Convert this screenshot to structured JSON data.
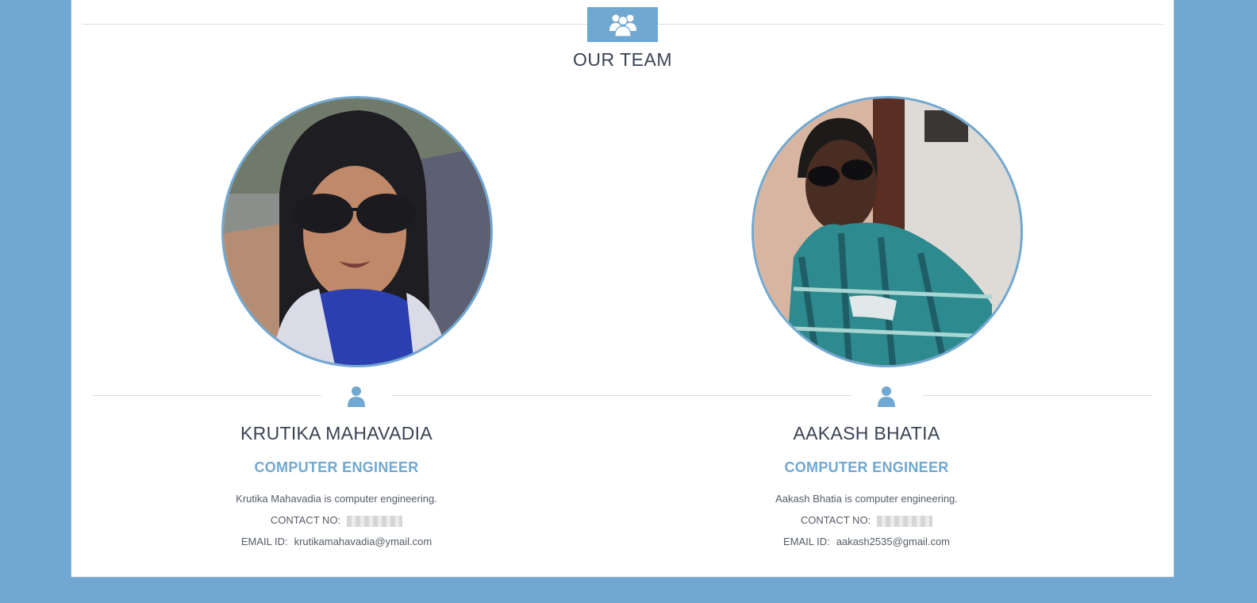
{
  "section": {
    "title": "OUR TEAM",
    "icon": "team-icon"
  },
  "members": [
    {
      "name": "KRUTIKA MAHAVADIA",
      "role": "COMPUTER ENGINEER",
      "description": "Krutika Mahavadia is computer engineering.",
      "contact_label": "CONTACT NO:",
      "email_label": "EMAIL ID:",
      "email": "krutikamahavadia@ymail.com",
      "photo": "profile-photo",
      "icon": "person-icon"
    },
    {
      "name": "AAKASH BHATIA",
      "role": "COMPUTER ENGINEER",
      "description": "Aakash Bhatia is computer engineering.",
      "contact_label": "CONTACT NO:",
      "email_label": "EMAIL ID:",
      "email": "aakash2535@gmail.com",
      "photo": "profile-photo",
      "icon": "person-icon"
    }
  ],
  "colors": {
    "accent": "#71a8d1",
    "text": "#3a4251",
    "background": "#ffffff"
  }
}
